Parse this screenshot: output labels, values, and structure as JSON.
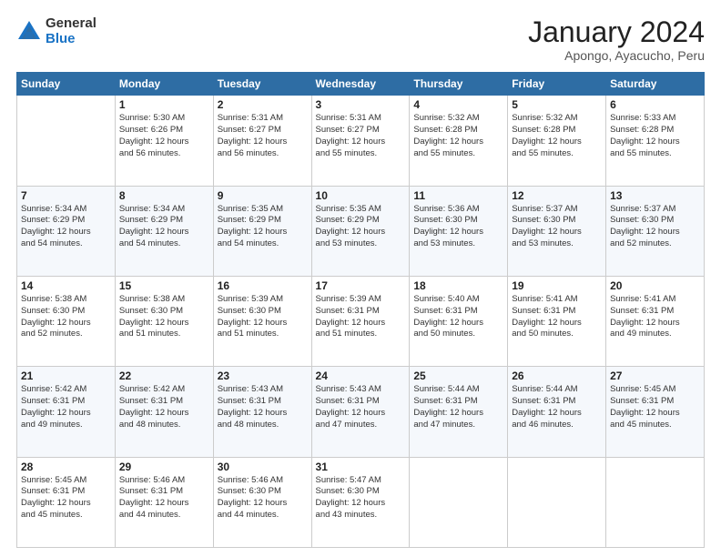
{
  "logo": {
    "general": "General",
    "blue": "Blue"
  },
  "header": {
    "title": "January 2024",
    "location": "Apongo, Ayacucho, Peru"
  },
  "weekdays": [
    "Sunday",
    "Monday",
    "Tuesday",
    "Wednesday",
    "Thursday",
    "Friday",
    "Saturday"
  ],
  "weeks": [
    [
      {
        "day": "",
        "info": ""
      },
      {
        "day": "1",
        "info": "Sunrise: 5:30 AM\nSunset: 6:26 PM\nDaylight: 12 hours\nand 56 minutes."
      },
      {
        "day": "2",
        "info": "Sunrise: 5:31 AM\nSunset: 6:27 PM\nDaylight: 12 hours\nand 56 minutes."
      },
      {
        "day": "3",
        "info": "Sunrise: 5:31 AM\nSunset: 6:27 PM\nDaylight: 12 hours\nand 55 minutes."
      },
      {
        "day": "4",
        "info": "Sunrise: 5:32 AM\nSunset: 6:28 PM\nDaylight: 12 hours\nand 55 minutes."
      },
      {
        "day": "5",
        "info": "Sunrise: 5:32 AM\nSunset: 6:28 PM\nDaylight: 12 hours\nand 55 minutes."
      },
      {
        "day": "6",
        "info": "Sunrise: 5:33 AM\nSunset: 6:28 PM\nDaylight: 12 hours\nand 55 minutes."
      }
    ],
    [
      {
        "day": "7",
        "info": "Sunrise: 5:34 AM\nSunset: 6:29 PM\nDaylight: 12 hours\nand 54 minutes."
      },
      {
        "day": "8",
        "info": "Sunrise: 5:34 AM\nSunset: 6:29 PM\nDaylight: 12 hours\nand 54 minutes."
      },
      {
        "day": "9",
        "info": "Sunrise: 5:35 AM\nSunset: 6:29 PM\nDaylight: 12 hours\nand 54 minutes."
      },
      {
        "day": "10",
        "info": "Sunrise: 5:35 AM\nSunset: 6:29 PM\nDaylight: 12 hours\nand 53 minutes."
      },
      {
        "day": "11",
        "info": "Sunrise: 5:36 AM\nSunset: 6:30 PM\nDaylight: 12 hours\nand 53 minutes."
      },
      {
        "day": "12",
        "info": "Sunrise: 5:37 AM\nSunset: 6:30 PM\nDaylight: 12 hours\nand 53 minutes."
      },
      {
        "day": "13",
        "info": "Sunrise: 5:37 AM\nSunset: 6:30 PM\nDaylight: 12 hours\nand 52 minutes."
      }
    ],
    [
      {
        "day": "14",
        "info": "Sunrise: 5:38 AM\nSunset: 6:30 PM\nDaylight: 12 hours\nand 52 minutes."
      },
      {
        "day": "15",
        "info": "Sunrise: 5:38 AM\nSunset: 6:30 PM\nDaylight: 12 hours\nand 51 minutes."
      },
      {
        "day": "16",
        "info": "Sunrise: 5:39 AM\nSunset: 6:30 PM\nDaylight: 12 hours\nand 51 minutes."
      },
      {
        "day": "17",
        "info": "Sunrise: 5:39 AM\nSunset: 6:31 PM\nDaylight: 12 hours\nand 51 minutes."
      },
      {
        "day": "18",
        "info": "Sunrise: 5:40 AM\nSunset: 6:31 PM\nDaylight: 12 hours\nand 50 minutes."
      },
      {
        "day": "19",
        "info": "Sunrise: 5:41 AM\nSunset: 6:31 PM\nDaylight: 12 hours\nand 50 minutes."
      },
      {
        "day": "20",
        "info": "Sunrise: 5:41 AM\nSunset: 6:31 PM\nDaylight: 12 hours\nand 49 minutes."
      }
    ],
    [
      {
        "day": "21",
        "info": "Sunrise: 5:42 AM\nSunset: 6:31 PM\nDaylight: 12 hours\nand 49 minutes."
      },
      {
        "day": "22",
        "info": "Sunrise: 5:42 AM\nSunset: 6:31 PM\nDaylight: 12 hours\nand 48 minutes."
      },
      {
        "day": "23",
        "info": "Sunrise: 5:43 AM\nSunset: 6:31 PM\nDaylight: 12 hours\nand 48 minutes."
      },
      {
        "day": "24",
        "info": "Sunrise: 5:43 AM\nSunset: 6:31 PM\nDaylight: 12 hours\nand 47 minutes."
      },
      {
        "day": "25",
        "info": "Sunrise: 5:44 AM\nSunset: 6:31 PM\nDaylight: 12 hours\nand 47 minutes."
      },
      {
        "day": "26",
        "info": "Sunrise: 5:44 AM\nSunset: 6:31 PM\nDaylight: 12 hours\nand 46 minutes."
      },
      {
        "day": "27",
        "info": "Sunrise: 5:45 AM\nSunset: 6:31 PM\nDaylight: 12 hours\nand 45 minutes."
      }
    ],
    [
      {
        "day": "28",
        "info": "Sunrise: 5:45 AM\nSunset: 6:31 PM\nDaylight: 12 hours\nand 45 minutes."
      },
      {
        "day": "29",
        "info": "Sunrise: 5:46 AM\nSunset: 6:31 PM\nDaylight: 12 hours\nand 44 minutes."
      },
      {
        "day": "30",
        "info": "Sunrise: 5:46 AM\nSunset: 6:30 PM\nDaylight: 12 hours\nand 44 minutes."
      },
      {
        "day": "31",
        "info": "Sunrise: 5:47 AM\nSunset: 6:30 PM\nDaylight: 12 hours\nand 43 minutes."
      },
      {
        "day": "",
        "info": ""
      },
      {
        "day": "",
        "info": ""
      },
      {
        "day": "",
        "info": ""
      }
    ]
  ]
}
